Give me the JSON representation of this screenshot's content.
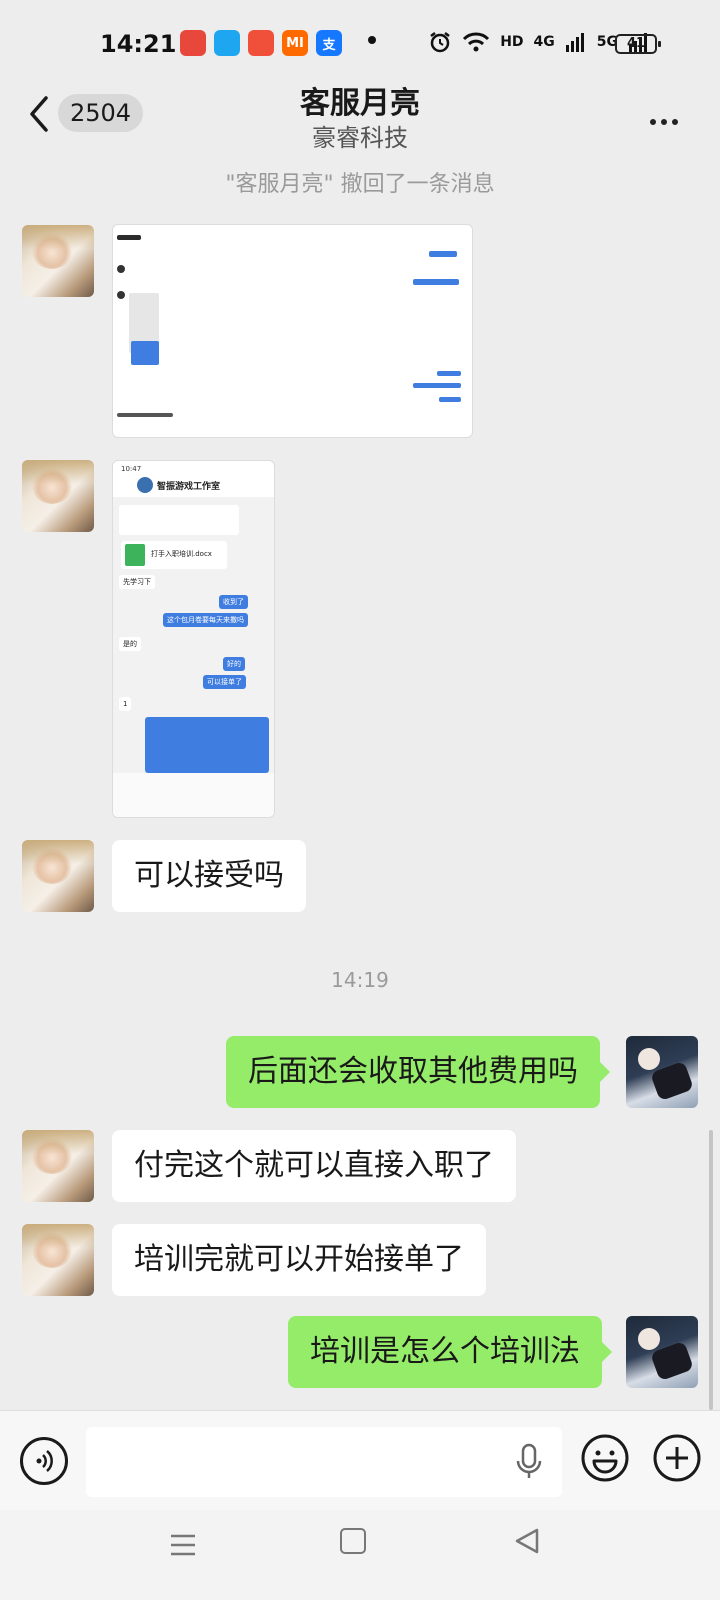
{
  "status_bar": {
    "time": "14:21",
    "app_icons": [
      {
        "name": "maps-icon",
        "color": "#e8473b",
        "label": ""
      },
      {
        "name": "qq-icon",
        "color": "#1ea7f0",
        "label": ""
      },
      {
        "name": "video-app-icon",
        "color": "#f04f3a",
        "label": ""
      },
      {
        "name": "mi-store-icon",
        "color": "#ff6a00",
        "label": "MI"
      },
      {
        "name": "alipay-icon",
        "color": "#1677ff",
        "label": "支"
      }
    ],
    "network_1": "4G",
    "network_2": "5G",
    "hd_label": "HD",
    "battery": "41"
  },
  "header": {
    "unread_count": "2504",
    "title": "客服月亮",
    "subtitle": "豪睿科技"
  },
  "system_message": "\"客服月亮\" 撤回了一条消息",
  "image_messages": {
    "second": {
      "status_time": "10:47",
      "title": "智振游戏工作室",
      "file_name": "打手入职培训.docx",
      "texts": [
        "先学习下",
        "收到了",
        "这个包月卷要每天来撒吗",
        "是的",
        "好的",
        "可以接单了",
        "1"
      ]
    }
  },
  "messages": [
    {
      "side": "in",
      "text": "可以接受吗"
    },
    {
      "side": "out",
      "text": "后面还会收取其他费用吗"
    },
    {
      "side": "in",
      "text": "付完这个就可以直接入职了"
    },
    {
      "side": "in",
      "text": "培训完就可以开始接单了"
    },
    {
      "side": "out",
      "text": "培训是怎么个培训法"
    }
  ],
  "timestamp": "14:19",
  "input": {
    "value": "",
    "placeholder": ""
  },
  "colors": {
    "outgoing_bubble": "#95ec69",
    "incoming_bubble": "#ffffff",
    "background": "#ededed"
  }
}
